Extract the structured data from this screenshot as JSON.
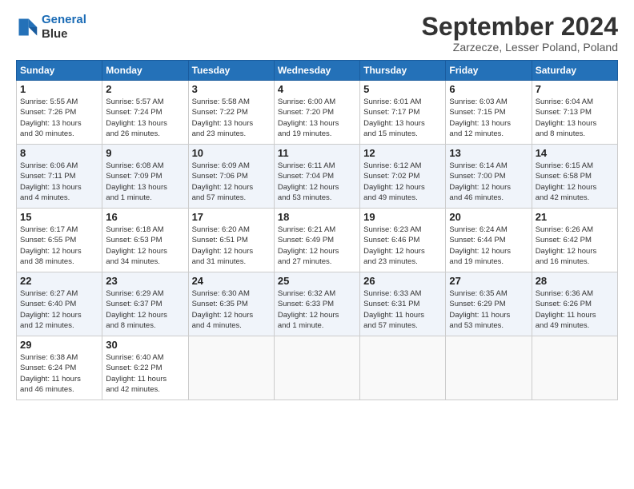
{
  "header": {
    "logo_line1": "General",
    "logo_line2": "Blue",
    "title": "September 2024",
    "subtitle": "Zarzecze, Lesser Poland, Poland"
  },
  "weekdays": [
    "Sunday",
    "Monday",
    "Tuesday",
    "Wednesday",
    "Thursday",
    "Friday",
    "Saturday"
  ],
  "weeks": [
    [
      {
        "day": "1",
        "info": "Sunrise: 5:55 AM\nSunset: 7:26 PM\nDaylight: 13 hours\nand 30 minutes."
      },
      {
        "day": "2",
        "info": "Sunrise: 5:57 AM\nSunset: 7:24 PM\nDaylight: 13 hours\nand 26 minutes."
      },
      {
        "day": "3",
        "info": "Sunrise: 5:58 AM\nSunset: 7:22 PM\nDaylight: 13 hours\nand 23 minutes."
      },
      {
        "day": "4",
        "info": "Sunrise: 6:00 AM\nSunset: 7:20 PM\nDaylight: 13 hours\nand 19 minutes."
      },
      {
        "day": "5",
        "info": "Sunrise: 6:01 AM\nSunset: 7:17 PM\nDaylight: 13 hours\nand 15 minutes."
      },
      {
        "day": "6",
        "info": "Sunrise: 6:03 AM\nSunset: 7:15 PM\nDaylight: 13 hours\nand 12 minutes."
      },
      {
        "day": "7",
        "info": "Sunrise: 6:04 AM\nSunset: 7:13 PM\nDaylight: 13 hours\nand 8 minutes."
      }
    ],
    [
      {
        "day": "8",
        "info": "Sunrise: 6:06 AM\nSunset: 7:11 PM\nDaylight: 13 hours\nand 4 minutes."
      },
      {
        "day": "9",
        "info": "Sunrise: 6:08 AM\nSunset: 7:09 PM\nDaylight: 13 hours\nand 1 minute."
      },
      {
        "day": "10",
        "info": "Sunrise: 6:09 AM\nSunset: 7:06 PM\nDaylight: 12 hours\nand 57 minutes."
      },
      {
        "day": "11",
        "info": "Sunrise: 6:11 AM\nSunset: 7:04 PM\nDaylight: 12 hours\nand 53 minutes."
      },
      {
        "day": "12",
        "info": "Sunrise: 6:12 AM\nSunset: 7:02 PM\nDaylight: 12 hours\nand 49 minutes."
      },
      {
        "day": "13",
        "info": "Sunrise: 6:14 AM\nSunset: 7:00 PM\nDaylight: 12 hours\nand 46 minutes."
      },
      {
        "day": "14",
        "info": "Sunrise: 6:15 AM\nSunset: 6:58 PM\nDaylight: 12 hours\nand 42 minutes."
      }
    ],
    [
      {
        "day": "15",
        "info": "Sunrise: 6:17 AM\nSunset: 6:55 PM\nDaylight: 12 hours\nand 38 minutes."
      },
      {
        "day": "16",
        "info": "Sunrise: 6:18 AM\nSunset: 6:53 PM\nDaylight: 12 hours\nand 34 minutes."
      },
      {
        "day": "17",
        "info": "Sunrise: 6:20 AM\nSunset: 6:51 PM\nDaylight: 12 hours\nand 31 minutes."
      },
      {
        "day": "18",
        "info": "Sunrise: 6:21 AM\nSunset: 6:49 PM\nDaylight: 12 hours\nand 27 minutes."
      },
      {
        "day": "19",
        "info": "Sunrise: 6:23 AM\nSunset: 6:46 PM\nDaylight: 12 hours\nand 23 minutes."
      },
      {
        "day": "20",
        "info": "Sunrise: 6:24 AM\nSunset: 6:44 PM\nDaylight: 12 hours\nand 19 minutes."
      },
      {
        "day": "21",
        "info": "Sunrise: 6:26 AM\nSunset: 6:42 PM\nDaylight: 12 hours\nand 16 minutes."
      }
    ],
    [
      {
        "day": "22",
        "info": "Sunrise: 6:27 AM\nSunset: 6:40 PM\nDaylight: 12 hours\nand 12 minutes."
      },
      {
        "day": "23",
        "info": "Sunrise: 6:29 AM\nSunset: 6:37 PM\nDaylight: 12 hours\nand 8 minutes."
      },
      {
        "day": "24",
        "info": "Sunrise: 6:30 AM\nSunset: 6:35 PM\nDaylight: 12 hours\nand 4 minutes."
      },
      {
        "day": "25",
        "info": "Sunrise: 6:32 AM\nSunset: 6:33 PM\nDaylight: 12 hours\nand 1 minute."
      },
      {
        "day": "26",
        "info": "Sunrise: 6:33 AM\nSunset: 6:31 PM\nDaylight: 11 hours\nand 57 minutes."
      },
      {
        "day": "27",
        "info": "Sunrise: 6:35 AM\nSunset: 6:29 PM\nDaylight: 11 hours\nand 53 minutes."
      },
      {
        "day": "28",
        "info": "Sunrise: 6:36 AM\nSunset: 6:26 PM\nDaylight: 11 hours\nand 49 minutes."
      }
    ],
    [
      {
        "day": "29",
        "info": "Sunrise: 6:38 AM\nSunset: 6:24 PM\nDaylight: 11 hours\nand 46 minutes."
      },
      {
        "day": "30",
        "info": "Sunrise: 6:40 AM\nSunset: 6:22 PM\nDaylight: 11 hours\nand 42 minutes."
      },
      {
        "day": "",
        "info": ""
      },
      {
        "day": "",
        "info": ""
      },
      {
        "day": "",
        "info": ""
      },
      {
        "day": "",
        "info": ""
      },
      {
        "day": "",
        "info": ""
      }
    ]
  ]
}
